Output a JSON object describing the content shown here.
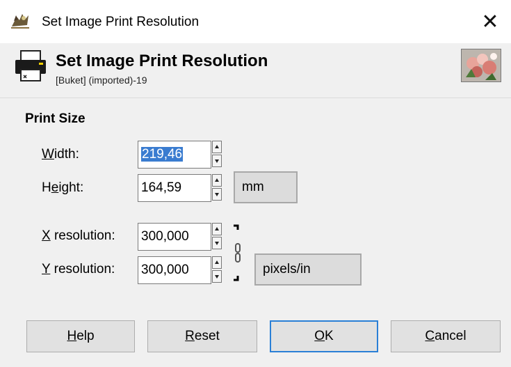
{
  "window": {
    "title": "Set Image Print Resolution",
    "close_icon": "close-icon"
  },
  "header": {
    "title": "Set Image Print Resolution",
    "subtitle": "[Buket] (imported)-19",
    "icon": "printer-icon"
  },
  "print_size": {
    "section_label": "Print Size",
    "width": {
      "label_mnemonic": "W",
      "label_rest": "idth:",
      "value": "219,46"
    },
    "height": {
      "label_pre": "H",
      "label_mnemonic": "e",
      "label_rest": "ight:",
      "value": "164,59"
    },
    "size_unit": "mm",
    "x_resolution": {
      "label_mnemonic": "X",
      "label_rest": " resolution:",
      "value": "300,000"
    },
    "y_resolution": {
      "label_mnemonic": "Y",
      "label_rest": " resolution:",
      "value": "300,000"
    },
    "resolution_unit": "pixels/in"
  },
  "buttons": {
    "help": {
      "mnemonic": "H",
      "rest": "elp"
    },
    "reset": {
      "mnemonic": "R",
      "rest": "eset"
    },
    "ok": {
      "mnemonic": "O",
      "rest": "K"
    },
    "cancel": {
      "mnemonic": "C",
      "rest": "ancel"
    }
  },
  "colors": {
    "selection": "#3a7cd0",
    "default_button_border": "#2a7fd6",
    "window_bg": "#f0f0f0"
  }
}
